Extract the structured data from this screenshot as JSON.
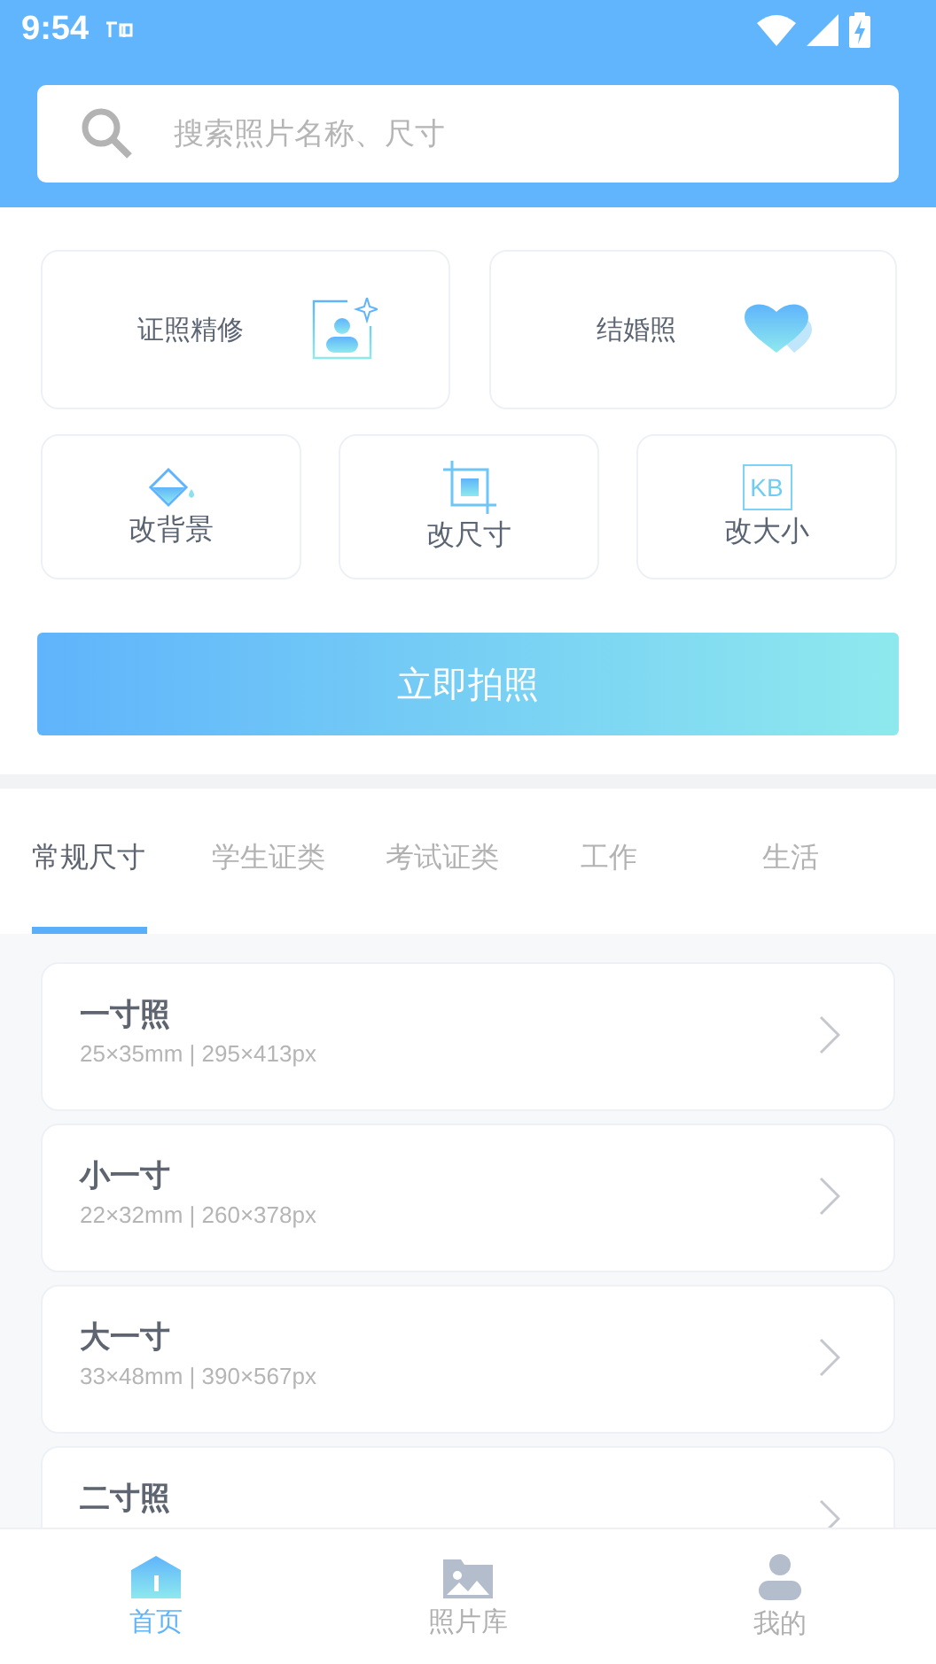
{
  "status_bar": {
    "time": "9:54"
  },
  "search": {
    "placeholder": "搜索照片名称、尺寸"
  },
  "features": [
    {
      "label": "证照精修",
      "kind": "portrait"
    },
    {
      "label": "结婚照",
      "kind": "heart"
    },
    {
      "label": "改背景",
      "kind": "bucket"
    },
    {
      "label": "改尺寸",
      "kind": "crop"
    },
    {
      "label": "改大小",
      "kind": "kb",
      "badge": "KB"
    }
  ],
  "primary_button": "立即拍照",
  "tabs": [
    {
      "label": "常规尺寸",
      "selected": true
    },
    {
      "label": "学生证类",
      "selected": false
    },
    {
      "label": "考试证类",
      "selected": false
    },
    {
      "label": "工作",
      "selected": false
    },
    {
      "label": "生活",
      "selected": false
    }
  ],
  "sizes": [
    {
      "title": "一寸照",
      "spec": "25×35mm | 295×413px"
    },
    {
      "title": "小一寸",
      "spec": "22×32mm | 260×378px"
    },
    {
      "title": "大一寸",
      "spec": "33×48mm | 390×567px"
    },
    {
      "title": "二寸照"
    }
  ],
  "bottom_nav": [
    {
      "label": "首页",
      "kind": "home",
      "selected": true
    },
    {
      "label": "照片库",
      "kind": "gallery",
      "selected": false
    },
    {
      "label": "我的",
      "kind": "profile",
      "selected": false
    }
  ]
}
